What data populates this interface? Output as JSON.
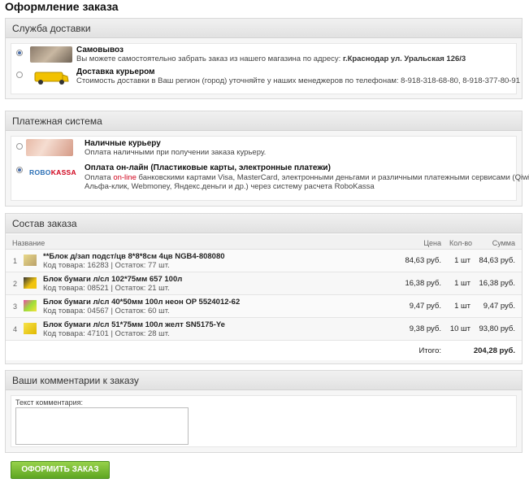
{
  "page_title": "Оформление заказа",
  "delivery": {
    "header": "Служба доставки",
    "options": [
      {
        "title": "Самовывоз",
        "desc": "Вы можете самостоятельно забрать заказ из нашего магазина по адресу:",
        "address": "г.Краснодар ул. Уральская 126/3",
        "selected": true,
        "icon": "pickup-photo-icon"
      },
      {
        "title": "Доставка курьером",
        "desc": "Стоимость доставки в Ваш регион (город) уточняйте у наших менеджеров по телефонам: 8-918-318-68-80, 8-918-377-80-91",
        "selected": false,
        "icon": "courier-van-icon"
      }
    ]
  },
  "payment": {
    "header": "Платежная система",
    "options": [
      {
        "title": "Наличные курьеру",
        "desc": "Оплата наличными при получении заказа курьеру.",
        "selected": false,
        "icon": "cash-icon"
      },
      {
        "title": "Оплата он-лайн (Пластиковые карты, электронные платежи)",
        "desc_pre": "Оплата",
        "desc_highlight": "on-line",
        "desc_post": "банковскими картами Visa, MasterCard, электронными деньгами и различными платежными сервисами (Qiwi,",
        "desc_line2": "Альфа-клик, Webmoney, Яндекс.деньги и др.) через систему расчета RoboKassa",
        "selected": true,
        "icon": "robokassa-logo-icon",
        "logo_text_a": "ROBO",
        "logo_text_b": "KASSA"
      }
    ]
  },
  "order": {
    "header": "Состав заказа",
    "columns": {
      "name": "Название",
      "price": "Цена",
      "qty": "Кол-во",
      "sum": "Сумма"
    },
    "rows": [
      {
        "num": "1",
        "name": "**Блок д/зап подст/цв 8*8*8см 4цв NGB4-808080",
        "code": "Код товара: 16283 | Остаток: 77 шт.",
        "price": "84,63 руб.",
        "qty": "1 шт",
        "sum": "84,63 руб."
      },
      {
        "num": "2",
        "name": "Блок бумаги л/сл 102*75мм 657 100л",
        "code": "Код товара: 08521 | Остаток: 21 шт.",
        "price": "16,38 руб.",
        "qty": "1 шт",
        "sum": "16,38 руб."
      },
      {
        "num": "3",
        "name": "Блок бумаги л/сл 40*50мм 100л неон OP 5524012-62",
        "code": "Код товара: 04567 | Остаток: 60 шт.",
        "price": "9,47 руб.",
        "qty": "1 шт",
        "sum": "9,47 руб."
      },
      {
        "num": "4",
        "name": "Блок бумаги л/сл 51*75мм 100л желт SN5175-Ye",
        "code": "Код товара: 47101 | Остаток: 28 шт.",
        "price": "9,38 руб.",
        "qty": "10 шт",
        "sum": "93,80 руб."
      }
    ],
    "total_label": "Итого:",
    "total_value": "204,28 руб."
  },
  "comments": {
    "header": "Ваши комментарии к заказу",
    "label": "Текст комментария:",
    "value": ""
  },
  "submit_label": "ОФОРМИТЬ ЗАКАЗ",
  "colors": {
    "accent_green": "#5ea622",
    "highlight_red": "#d0021b",
    "radio_blue": "#4a6ea8"
  }
}
